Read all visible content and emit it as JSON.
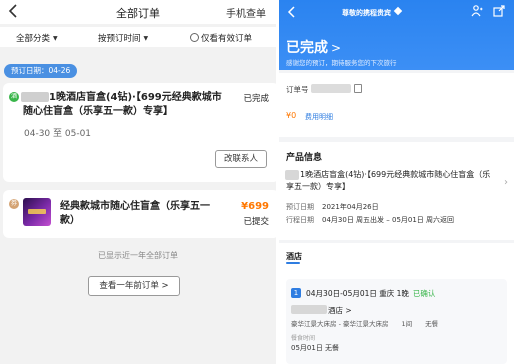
{
  "left": {
    "title": "全部订单",
    "phone_lookup": "手机查单",
    "filters": {
      "category": "全部分类",
      "sort": "按预订时间",
      "valid_only": "仅看有效订单"
    },
    "date_chip": "预订日期：04-26",
    "orders": [
      {
        "tag": "酒",
        "title": "1晚酒店盲盒(4钻)·【699元经典款城市随心住盲盒（乐享五一款）专享】",
        "status": "已完成",
        "dates": "04-30 至 05-01",
        "action": "改联系人"
      },
      {
        "tag": "券",
        "title": "经典款城市随心住盲盒（乐享五一款）",
        "price": "¥699",
        "status": "已提交"
      }
    ],
    "footer_note": "已显示近一年全部订单",
    "older_orders_button": "查看一年前订单 >"
  },
  "right": {
    "header": {
      "greeting": "尊敬的携程贵宾"
    },
    "status": "已完成",
    "status_chevron": ">",
    "thanks": "感谢您的预订，期待服务您的下次旅行",
    "order_number_label": "订单号",
    "amount": "¥0",
    "fee_link": "费用明细",
    "product": {
      "heading": "产品信息",
      "title": "1晚酒店盲盒(4钻)·【699元经典款城市随心住盲盒（乐享五一款）专享】",
      "booking_date_label": "预订日期",
      "booking_date": "2021年04月26日",
      "trip_time_label": "行程日期",
      "trip_time": "04月30日 周五出发 – 05月01日 周六返回"
    },
    "hotel": {
      "tab": "酒店",
      "index": "1",
      "stay": "04月30日-05月01日 重庆 1晚",
      "confirm": "已确认",
      "hotel_suffix": "酒店 >",
      "room": "豪华江景大床房 - 豪华江景大床房　　1间　　无餐",
      "meal_label": "餐食时间",
      "meal": "05月01日 无餐"
    }
  }
}
